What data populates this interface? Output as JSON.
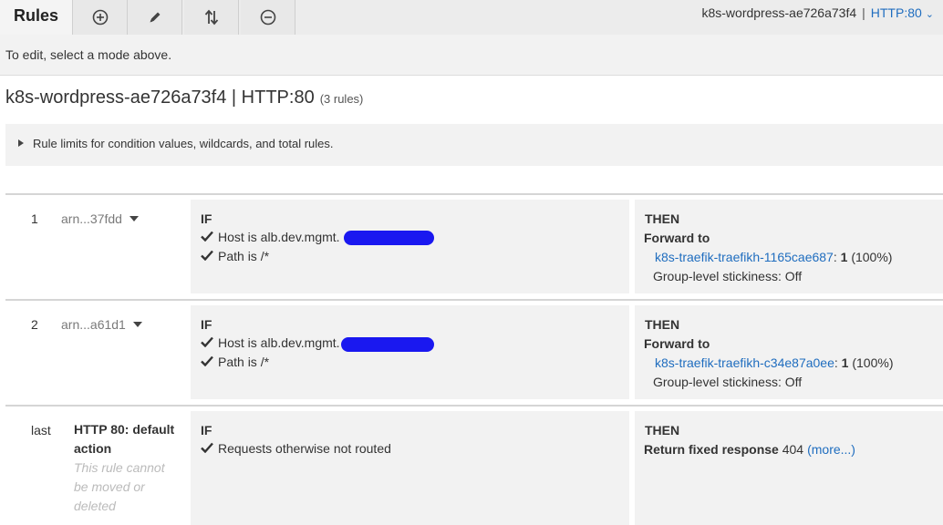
{
  "toolbar": {
    "rules_tab_label": "Rules",
    "mode_tabs": [
      {
        "icon": "plus-circle-icon",
        "label": "Add rules"
      },
      {
        "icon": "pencil-icon",
        "label": "Edit rules"
      },
      {
        "icon": "reorder-arrows-icon",
        "label": "Reorder rules"
      },
      {
        "icon": "minus-circle-icon",
        "label": "Delete rules"
      }
    ],
    "breadcrumb": {
      "load_balancer": "k8s-wordpress-ae726a73f4",
      "separator": "|",
      "listener": "HTTP:80"
    }
  },
  "hint_text": "To edit, select a mode above.",
  "header": {
    "title": "k8s-wordpress-ae726a73f4 | HTTP:80",
    "rule_count": "(3 rules)"
  },
  "limits_toggle_label": "Rule limits for condition values, wildcards, and total rules.",
  "rules": [
    {
      "priority": "1",
      "arn": "arn...37fdd",
      "if_label": "IF",
      "conditions": [
        "Host is alb.dev.mgmt.",
        "Path is /*"
      ],
      "then_label": "THEN",
      "action_title": "Forward to",
      "target_group": "k8s-traefik-traefikh-1165cae687",
      "target_suffix": ":",
      "weight": "1",
      "weight_pct": "(100%)",
      "stickiness": "Group-level stickiness: Off"
    },
    {
      "priority": "2",
      "arn": "arn...a61d1",
      "if_label": "IF",
      "conditions": [
        "Host is alb.dev.mgmt.",
        "Path is /*"
      ],
      "then_label": "THEN",
      "action_title": "Forward to",
      "target_group": "k8s-traefik-traefikh-c34e87a0ee",
      "target_suffix": ":",
      "weight": "1",
      "weight_pct": "(100%)",
      "stickiness": "Group-level stickiness: Off"
    },
    {
      "priority": "last",
      "default_label": "HTTP 80: default action",
      "default_note": "This rule cannot be moved or deleted",
      "if_label": "IF",
      "conditions": [
        "Requests otherwise not routed"
      ],
      "then_label": "THEN",
      "action_title": "Return fixed response",
      "status_code": "404",
      "more_link": "(more...)"
    }
  ],
  "colors": {
    "link": "#1f6dbf",
    "redaction": "#1a18f0"
  }
}
